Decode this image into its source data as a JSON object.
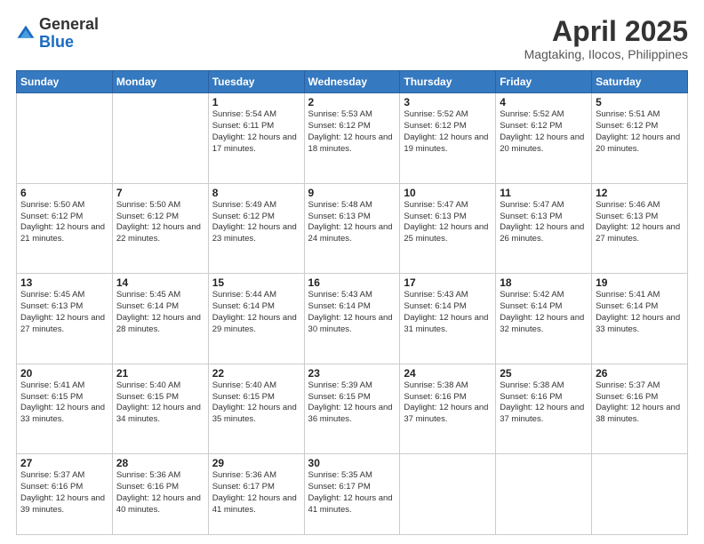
{
  "logo": {
    "general": "General",
    "blue": "Blue"
  },
  "title": "April 2025",
  "subtitle": "Magtaking, Ilocos, Philippines",
  "days_of_week": [
    "Sunday",
    "Monday",
    "Tuesday",
    "Wednesday",
    "Thursday",
    "Friday",
    "Saturday"
  ],
  "weeks": [
    [
      {
        "day": "",
        "info": ""
      },
      {
        "day": "",
        "info": ""
      },
      {
        "day": "1",
        "info": "Sunrise: 5:54 AM\nSunset: 6:11 PM\nDaylight: 12 hours and 17 minutes."
      },
      {
        "day": "2",
        "info": "Sunrise: 5:53 AM\nSunset: 6:12 PM\nDaylight: 12 hours and 18 minutes."
      },
      {
        "day": "3",
        "info": "Sunrise: 5:52 AM\nSunset: 6:12 PM\nDaylight: 12 hours and 19 minutes."
      },
      {
        "day": "4",
        "info": "Sunrise: 5:52 AM\nSunset: 6:12 PM\nDaylight: 12 hours and 20 minutes."
      },
      {
        "day": "5",
        "info": "Sunrise: 5:51 AM\nSunset: 6:12 PM\nDaylight: 12 hours and 20 minutes."
      }
    ],
    [
      {
        "day": "6",
        "info": "Sunrise: 5:50 AM\nSunset: 6:12 PM\nDaylight: 12 hours and 21 minutes."
      },
      {
        "day": "7",
        "info": "Sunrise: 5:50 AM\nSunset: 6:12 PM\nDaylight: 12 hours and 22 minutes."
      },
      {
        "day": "8",
        "info": "Sunrise: 5:49 AM\nSunset: 6:12 PM\nDaylight: 12 hours and 23 minutes."
      },
      {
        "day": "9",
        "info": "Sunrise: 5:48 AM\nSunset: 6:13 PM\nDaylight: 12 hours and 24 minutes."
      },
      {
        "day": "10",
        "info": "Sunrise: 5:47 AM\nSunset: 6:13 PM\nDaylight: 12 hours and 25 minutes."
      },
      {
        "day": "11",
        "info": "Sunrise: 5:47 AM\nSunset: 6:13 PM\nDaylight: 12 hours and 26 minutes."
      },
      {
        "day": "12",
        "info": "Sunrise: 5:46 AM\nSunset: 6:13 PM\nDaylight: 12 hours and 27 minutes."
      }
    ],
    [
      {
        "day": "13",
        "info": "Sunrise: 5:45 AM\nSunset: 6:13 PM\nDaylight: 12 hours and 27 minutes."
      },
      {
        "day": "14",
        "info": "Sunrise: 5:45 AM\nSunset: 6:14 PM\nDaylight: 12 hours and 28 minutes."
      },
      {
        "day": "15",
        "info": "Sunrise: 5:44 AM\nSunset: 6:14 PM\nDaylight: 12 hours and 29 minutes."
      },
      {
        "day": "16",
        "info": "Sunrise: 5:43 AM\nSunset: 6:14 PM\nDaylight: 12 hours and 30 minutes."
      },
      {
        "day": "17",
        "info": "Sunrise: 5:43 AM\nSunset: 6:14 PM\nDaylight: 12 hours and 31 minutes."
      },
      {
        "day": "18",
        "info": "Sunrise: 5:42 AM\nSunset: 6:14 PM\nDaylight: 12 hours and 32 minutes."
      },
      {
        "day": "19",
        "info": "Sunrise: 5:41 AM\nSunset: 6:14 PM\nDaylight: 12 hours and 33 minutes."
      }
    ],
    [
      {
        "day": "20",
        "info": "Sunrise: 5:41 AM\nSunset: 6:15 PM\nDaylight: 12 hours and 33 minutes."
      },
      {
        "day": "21",
        "info": "Sunrise: 5:40 AM\nSunset: 6:15 PM\nDaylight: 12 hours and 34 minutes."
      },
      {
        "day": "22",
        "info": "Sunrise: 5:40 AM\nSunset: 6:15 PM\nDaylight: 12 hours and 35 minutes."
      },
      {
        "day": "23",
        "info": "Sunrise: 5:39 AM\nSunset: 6:15 PM\nDaylight: 12 hours and 36 minutes."
      },
      {
        "day": "24",
        "info": "Sunrise: 5:38 AM\nSunset: 6:16 PM\nDaylight: 12 hours and 37 minutes."
      },
      {
        "day": "25",
        "info": "Sunrise: 5:38 AM\nSunset: 6:16 PM\nDaylight: 12 hours and 37 minutes."
      },
      {
        "day": "26",
        "info": "Sunrise: 5:37 AM\nSunset: 6:16 PM\nDaylight: 12 hours and 38 minutes."
      }
    ],
    [
      {
        "day": "27",
        "info": "Sunrise: 5:37 AM\nSunset: 6:16 PM\nDaylight: 12 hours and 39 minutes."
      },
      {
        "day": "28",
        "info": "Sunrise: 5:36 AM\nSunset: 6:16 PM\nDaylight: 12 hours and 40 minutes."
      },
      {
        "day": "29",
        "info": "Sunrise: 5:36 AM\nSunset: 6:17 PM\nDaylight: 12 hours and 41 minutes."
      },
      {
        "day": "30",
        "info": "Sunrise: 5:35 AM\nSunset: 6:17 PM\nDaylight: 12 hours and 41 minutes."
      },
      {
        "day": "",
        "info": ""
      },
      {
        "day": "",
        "info": ""
      },
      {
        "day": "",
        "info": ""
      }
    ]
  ]
}
